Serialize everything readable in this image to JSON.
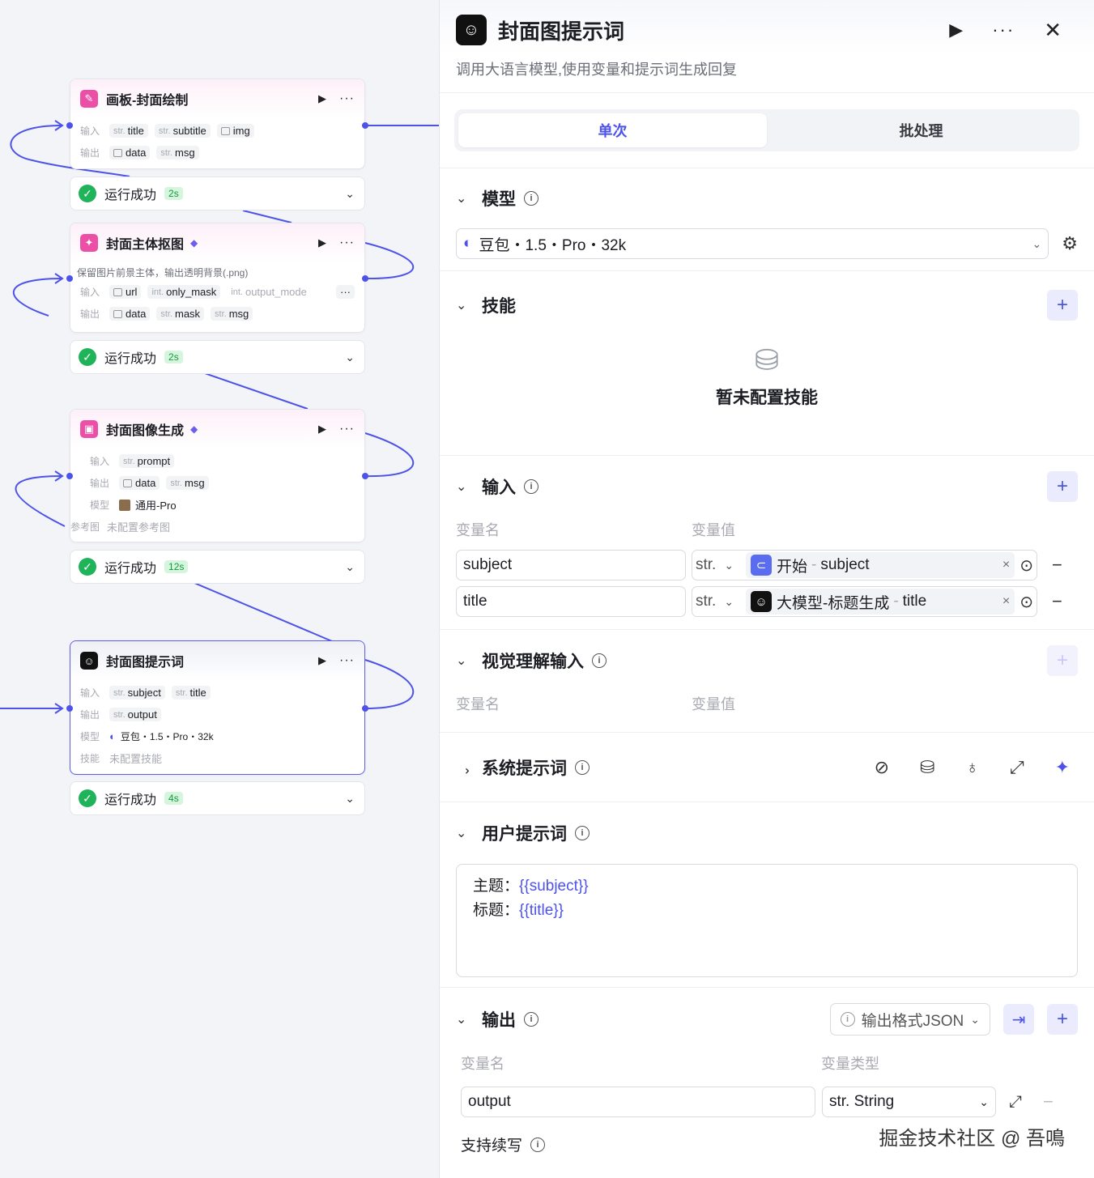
{
  "canvas": {
    "nodes": [
      {
        "title": "画板-封面绘制",
        "inputs_label": "输入",
        "outputs_label": "输出",
        "inputs": [
          {
            "type": "str.",
            "name": "title"
          },
          {
            "type": "str.",
            "name": "subtitle"
          },
          {
            "type": "img",
            "name": "img"
          }
        ],
        "outputs": [
          {
            "type": "img",
            "name": "data"
          },
          {
            "type": "str.",
            "name": "msg"
          }
        ]
      },
      {
        "title": "封面主体抠图",
        "description": "保留图片前景主体，输出透明背景(.png)",
        "inputs_label": "输入",
        "outputs_label": "输出",
        "inputs": [
          {
            "type": "img",
            "name": "url"
          },
          {
            "type": "int.",
            "name": "only_mask"
          },
          {
            "type": "int.",
            "name": "output_mode"
          }
        ],
        "outputs": [
          {
            "type": "img",
            "name": "data"
          },
          {
            "type": "str.",
            "name": "mask"
          },
          {
            "type": "str.",
            "name": "msg"
          }
        ]
      },
      {
        "title": "封面图像生成",
        "inputs_label": "输入",
        "outputs_label": "输出",
        "model_label": "模型",
        "ref_label": "参考图",
        "inputs": [
          {
            "type": "str.",
            "name": "prompt"
          }
        ],
        "outputs": [
          {
            "type": "img",
            "name": "data"
          },
          {
            "type": "str.",
            "name": "msg"
          }
        ],
        "model": "通用-Pro",
        "ref_value": "未配置参考图"
      },
      {
        "title": "封面图提示词",
        "inputs_label": "输入",
        "outputs_label": "输出",
        "model_label": "模型",
        "skill_label": "技能",
        "inputs": [
          {
            "type": "str.",
            "name": "subject"
          },
          {
            "type": "str.",
            "name": "title"
          }
        ],
        "outputs": [
          {
            "type": "str.",
            "name": "output"
          }
        ],
        "model": "豆包・1.5・Pro・32k",
        "skill_value": "未配置技能"
      }
    ],
    "statuses": [
      {
        "text": "运行成功",
        "time": "2s"
      },
      {
        "text": "运行成功",
        "time": "2s"
      },
      {
        "text": "运行成功",
        "time": "12s"
      },
      {
        "text": "运行成功",
        "time": "4s"
      }
    ]
  },
  "panel": {
    "title": "封面图提示词",
    "subtitle": "调用大语言模型,使用变量和提示词生成回复",
    "tabs": [
      "单次",
      "批处理"
    ],
    "model": {
      "label": "模型",
      "value": "豆包・1.5・Pro・32k"
    },
    "skills": {
      "label": "技能",
      "empty": "暂未配置技能"
    },
    "inputs": {
      "label": "输入",
      "col_name": "变量名",
      "col_value": "变量值",
      "rows": [
        {
          "name": "subject",
          "type": "str.",
          "source": "开始",
          "field": "subject"
        },
        {
          "name": "title",
          "type": "str.",
          "source": "大模型-标题生成",
          "field": "title"
        }
      ]
    },
    "visual": {
      "label": "视觉理解输入",
      "col_name": "变量名",
      "col_value": "变量值"
    },
    "system_prompt": {
      "label": "系统提示词"
    },
    "user_prompt": {
      "label": "用户提示词",
      "line1_label": "主题：",
      "line1_var": "{{subject}}",
      "line2_label": "标题：",
      "line2_var": "{{title}}"
    },
    "output": {
      "label": "输出",
      "format": "输出格式JSON",
      "col_name": "变量名",
      "col_type": "变量类型",
      "row_name": "output",
      "row_type": "str. String",
      "continue_label": "支持续写"
    },
    "watermark": "掘金技术社区 @ 吾鳴"
  }
}
